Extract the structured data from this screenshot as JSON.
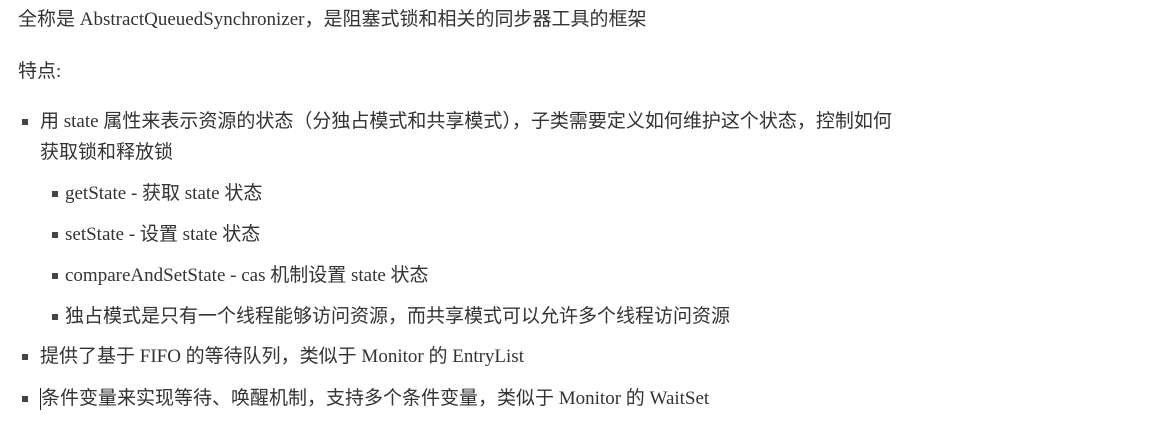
{
  "intro": "全称是 AbstractQueuedSynchronizer，是阻塞式锁和相关的同步器工具的框架",
  "features_label": "特点:",
  "items": [
    {
      "text_line1": "用 state 属性来表示资源的状态（分独占模式和共享模式），子类需要定义如何维护这个状态，控制如何",
      "text_line2": "获取锁和释放锁",
      "subitems": [
        "getState - 获取 state 状态",
        "setState - 设置 state 状态",
        "compareAndSetState - cas 机制设置 state 状态",
        "独占模式是只有一个线程能够访问资源，而共享模式可以允许多个线程访问资源"
      ]
    },
    {
      "text": "提供了基于 FIFO 的等待队列，类似于 Monitor 的 EntryList"
    },
    {
      "text": "条件变量来实现等待、唤醒机制，支持多个条件变量，类似于 Monitor 的 WaitSet"
    }
  ]
}
